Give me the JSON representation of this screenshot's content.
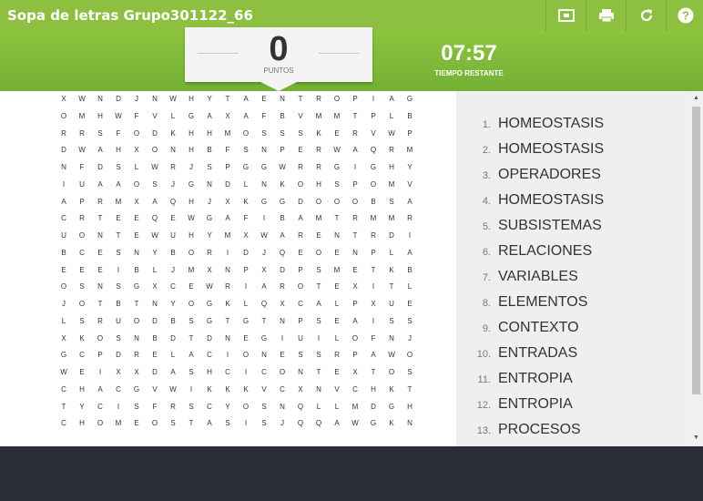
{
  "header": {
    "title": "Sopa de letras Grupo301122_66"
  },
  "toolbar": {
    "icons": [
      "fullscreen-icon",
      "print-icon",
      "restart-icon",
      "help-icon"
    ]
  },
  "score": {
    "value": "0",
    "label": "PUNTOS"
  },
  "timer": {
    "value": "07:57",
    "label": "TIEMPO RESTANTE"
  },
  "grid": [
    "XWNDJNWHYTAENTROPIAG",
    "OMHWFVLGAXAFBVMMTPLB",
    "RRSFODKHHMOSSSKERVWP",
    "DWAHXONHBFSNPERWAQRM",
    "NFDSLWRJSPGGWRRGIGHY",
    "IUAAOSJGNDLNKOHSPOMV",
    "APRMXAQHJXKGGDOOOBSA",
    "CRTEEQEWGAFIBAMTRMMR",
    "UONTEWUHYMXWARENTRDI",
    "BCESNYBORIDJQEOENPLA",
    "EEEIBLJMXNPXDPSMETKB",
    "OSNSGXCEWRIAROTEXITL",
    "JOTBTNYOGKLQXCALPXUE",
    "LSRUODBSGTGTNPSEAISS",
    "XKOSNBDTDNEGIUILOFNJ",
    "GCPDRELACIONESSRPAWO",
    "WEIXXDASHCICONTEXTOS",
    "CHACGVWIKKKVCXNVCHKT",
    "TYCISFRSCYOSNQLLMDGH",
    "CHOMEOSTASISJQQAWGKN"
  ],
  "words": [
    {
      "num": "1.",
      "text": "HOMEOSTASIS"
    },
    {
      "num": "2.",
      "text": "HOMEOSTASIS"
    },
    {
      "num": "3.",
      "text": "OPERADORES"
    },
    {
      "num": "4.",
      "text": "HOMEOSTASIS"
    },
    {
      "num": "5.",
      "text": "SUBSISTEMAS"
    },
    {
      "num": "6.",
      "text": "RELACIONES"
    },
    {
      "num": "7.",
      "text": "VARIABLES"
    },
    {
      "num": "8.",
      "text": "ELEMENTOS"
    },
    {
      "num": "9.",
      "text": "CONTEXTO"
    },
    {
      "num": "10.",
      "text": "ENTRADAS"
    },
    {
      "num": "11.",
      "text": "ENTROPIA"
    },
    {
      "num": "12.",
      "text": "ENTROPIA"
    },
    {
      "num": "13.",
      "text": "PROCESOS"
    }
  ]
}
